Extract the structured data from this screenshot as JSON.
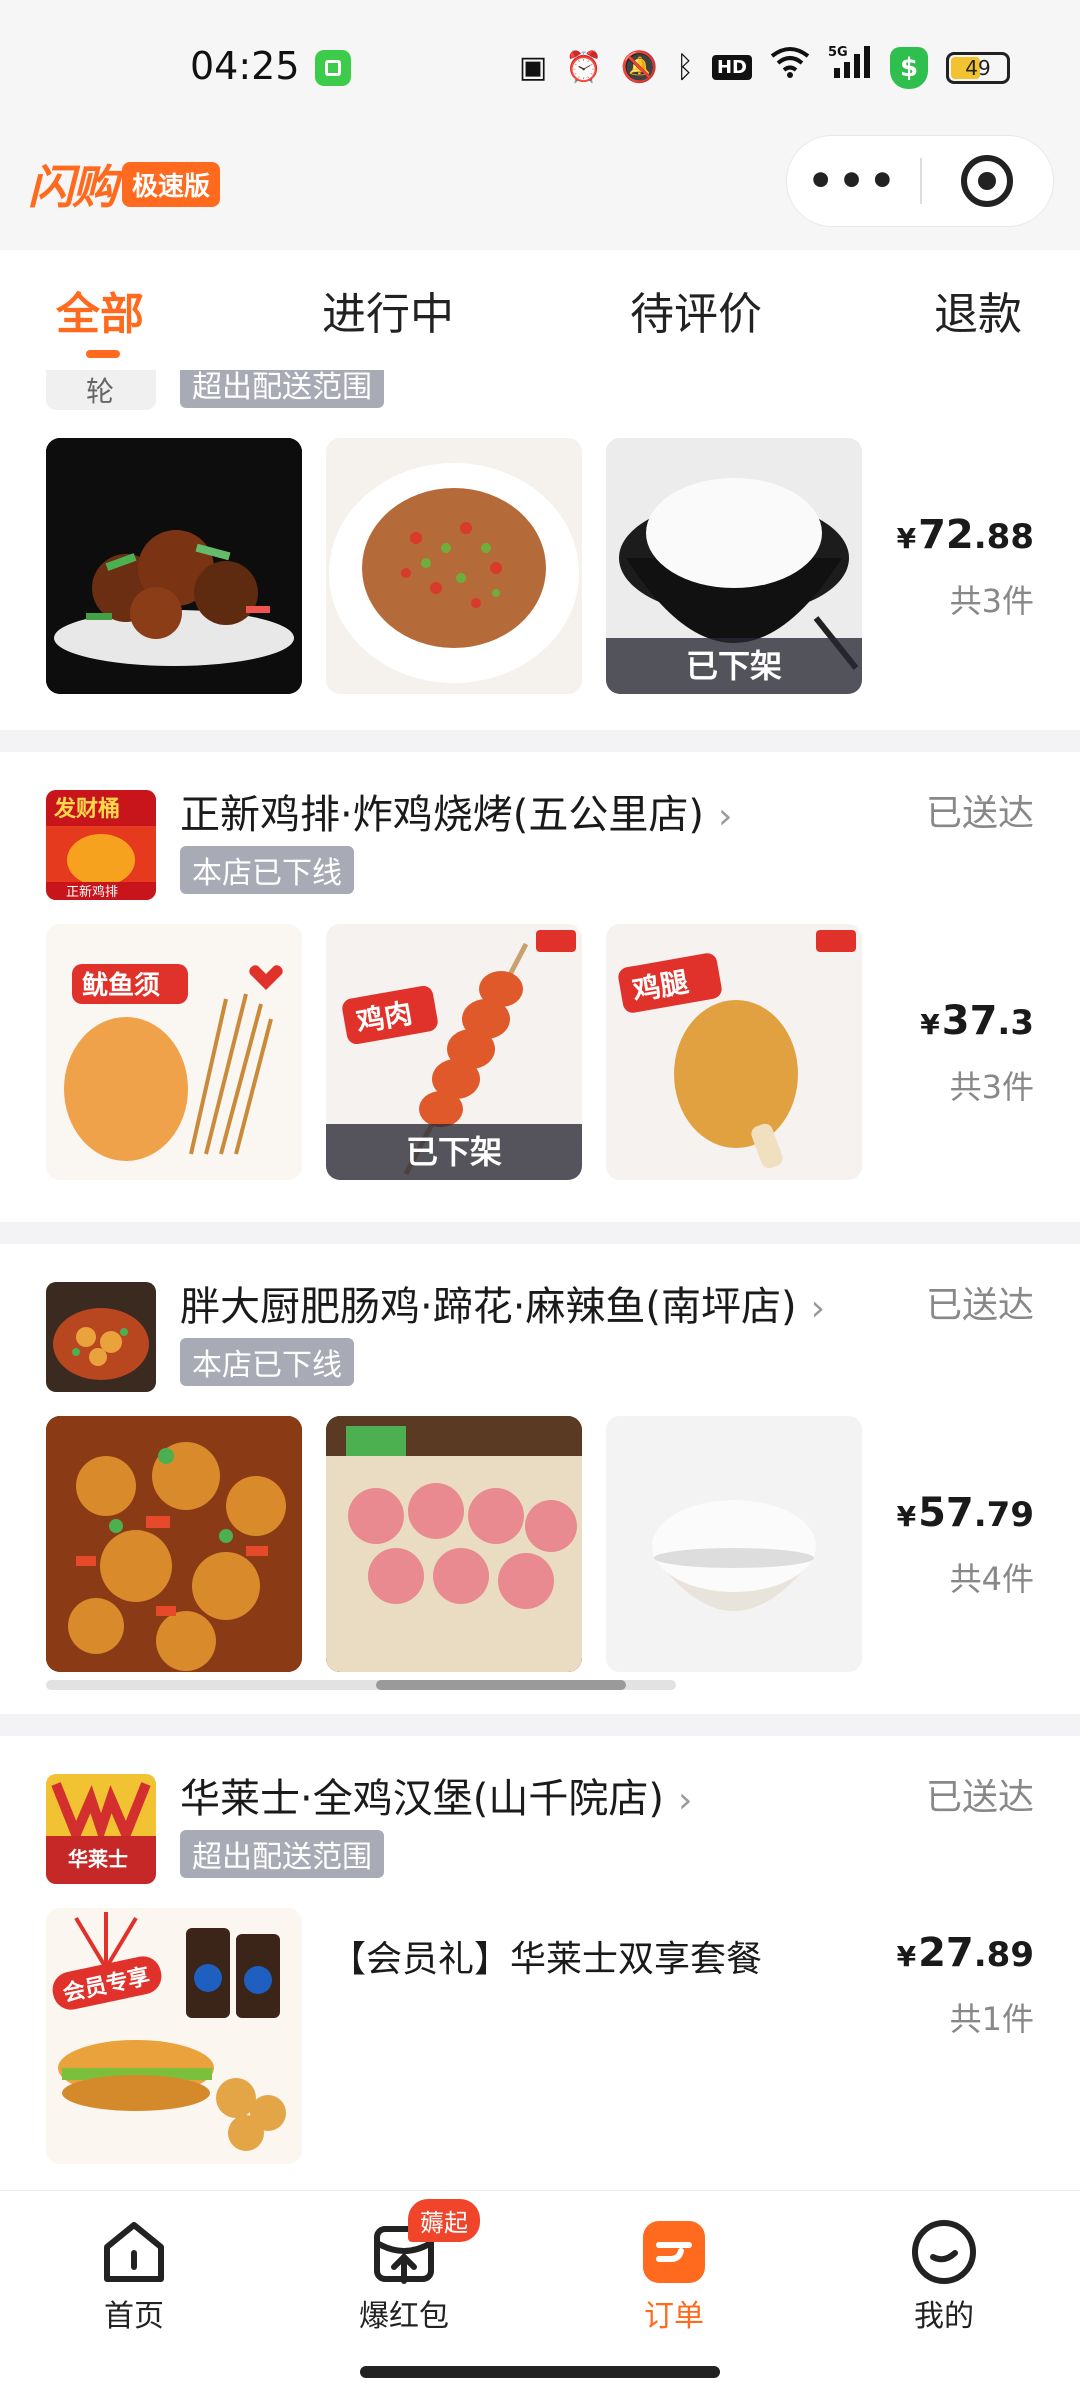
{
  "status_bar": {
    "time": "04:25",
    "battery": "49",
    "signal": "5G",
    "hd": "HD",
    "shield": "$"
  },
  "header": {
    "logo": "闪购",
    "logo_badge": "极速版",
    "more_icon": "more-dots-icon",
    "target_icon": "target-icon"
  },
  "tabs": [
    {
      "label": "全部",
      "active": true
    },
    {
      "label": "进行中",
      "active": false
    },
    {
      "label": "待评价",
      "active": false
    },
    {
      "label": "退款",
      "active": false
    }
  ],
  "orders": [
    {
      "store_name_partial": "轮",
      "badge": "超出配送范围",
      "thumbs": [
        {
          "name": "braised-chicken",
          "offline": null
        },
        {
          "name": "stir-fried-pork",
          "offline": null
        },
        {
          "name": "white-rice",
          "offline": "已下架"
        }
      ],
      "price_int": "72",
      "price_dec": ".88",
      "currency": "¥",
      "count": "共3件"
    },
    {
      "store_name": "正新鸡排·炸鸡烧烤(五公里店)",
      "badge": "本店已下线",
      "status": "已送达",
      "thumbs": [
        {
          "name": "squid-tentacles",
          "tag": "鱿鱼须",
          "offline": null
        },
        {
          "name": "chicken-skewer",
          "tag": "鸡肉",
          "offline": "已下架"
        },
        {
          "name": "chicken-leg",
          "tag": "鸡腿",
          "offline": null
        }
      ],
      "price_int": "37",
      "price_dec": ".3",
      "currency": "¥",
      "count": "共3件"
    },
    {
      "store_name": "胖大厨肥肠鸡·蹄花·麻辣鱼(南坪店)",
      "badge": "本店已下线",
      "status": "已送达",
      "thumbs": [
        {
          "name": "spicy-chicken-pot",
          "offline": null
        },
        {
          "name": "sliced-sausage",
          "offline": null
        },
        {
          "name": "rice-bowl",
          "offline": null
        }
      ],
      "price_int": "57",
      "price_dec": ".79",
      "currency": "¥",
      "count": "共4件"
    },
    {
      "store_name": "华莱士·全鸡汉堡(山千院店)",
      "badge": "超出配送范围",
      "status": "已送达",
      "item_title": "【会员礼】华莱士双享套餐",
      "thumb_tag": "会员专享",
      "price_int": "27",
      "price_dec": ".89",
      "currency": "¥",
      "count": "共1件"
    }
  ],
  "logo_text": {
    "zhengxin_top": "发财桶",
    "zhengxin_brand": "正新鸡排",
    "wallace_brand": "华莱士"
  },
  "bottom_nav": {
    "items": [
      {
        "label": "首页",
        "icon": "home-icon"
      },
      {
        "label": "爆红包",
        "icon": "red-packet-icon",
        "badge": "薅起"
      },
      {
        "label": "订单",
        "icon": "order-icon",
        "active": true
      },
      {
        "label": "我的",
        "icon": "profile-icon"
      }
    ]
  },
  "colors": {
    "accent": "#ff6a1f",
    "badge_gray": "#a8abb5",
    "status_gray": "#888888",
    "nav_badge": "#f0442b"
  }
}
